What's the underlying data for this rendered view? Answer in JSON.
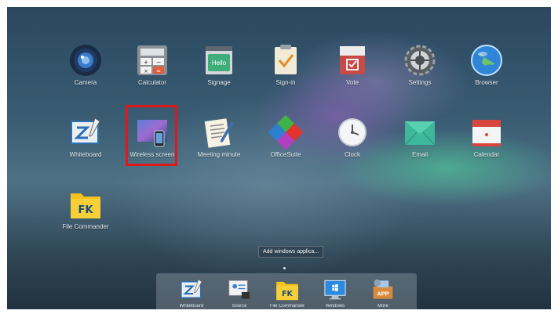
{
  "apps_row1": [
    {
      "label": "Camera",
      "icon": "camera-icon"
    },
    {
      "label": "Calculator",
      "icon": "calculator-icon"
    },
    {
      "label": "Signage",
      "icon": "signage-icon",
      "badge": "Hello"
    },
    {
      "label": "Sign-in",
      "icon": "sign-in-icon"
    },
    {
      "label": "Vote",
      "icon": "vote-icon"
    },
    {
      "label": "Settings",
      "icon": "settings-gear-icon"
    },
    {
      "label": "Browser",
      "icon": "browser-globe-icon"
    }
  ],
  "apps_row2": [
    {
      "label": "Whiteboard",
      "icon": "whiteboard-icon"
    },
    {
      "label": "Wireless screen",
      "icon": "wireless-screen-icon",
      "selected": true
    },
    {
      "label": "Meeting minute",
      "icon": "meeting-minutes-icon"
    },
    {
      "label": "OfficeSuite",
      "icon": "officesuite-icon"
    },
    {
      "label": "Clock",
      "icon": "clock-icon"
    },
    {
      "label": "Email",
      "icon": "email-icon"
    },
    {
      "label": "Calendar",
      "icon": "calendar-icon"
    }
  ],
  "apps_row3": [
    {
      "label": "File Commander",
      "icon": "file-commander-icon",
      "glyph": "FK"
    }
  ],
  "tooltip": "Add windows applica...",
  "dock": [
    {
      "label": "Whiteboard",
      "icon": "whiteboard-icon"
    },
    {
      "label": "Source",
      "icon": "source-icon"
    },
    {
      "label": "File Commander",
      "icon": "file-commander-icon",
      "glyph": "FK"
    },
    {
      "label": "Windows",
      "icon": "windows-icon"
    },
    {
      "label": "More",
      "icon": "more-apps-icon",
      "glyph": "APP"
    }
  ],
  "colors": {
    "selection_border": "#e01818",
    "calendar_red": "#d9453f",
    "vote_red": "#c64a45",
    "folder_yellow": "#f3c21d"
  }
}
